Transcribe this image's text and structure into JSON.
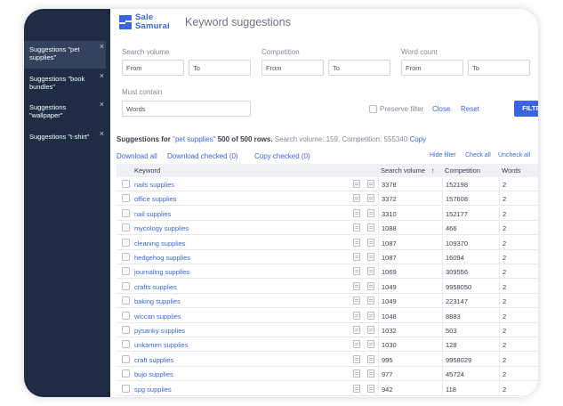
{
  "app": {
    "logo_line1": "Sale",
    "logo_line2": "Samurai",
    "title": "Keyword suggestions",
    "brand_color": "#3a65e0"
  },
  "sidebar": {
    "items": [
      {
        "label": "Suggestions \"pet supplies\"",
        "active": true
      },
      {
        "label": "Suggestions \"book bundles\"",
        "active": false
      },
      {
        "label": "Suggestions \"wallpaper\"",
        "active": false
      },
      {
        "label": "Suggestions \"t-shirt\"",
        "active": false
      }
    ],
    "close_glyph": "×"
  },
  "filters": {
    "search_volume_label": "Search volume",
    "competition_label": "Competition",
    "word_count_label": "Word count",
    "must_contain_label": "Must contain",
    "from_placeholder": "From",
    "to_placeholder": "To",
    "words_placeholder": "Words",
    "preserve_filter_label": "Preserve filter",
    "close_label": "Close",
    "reset_label": "Reset",
    "filter_button": "FILTER"
  },
  "summary": {
    "prefix": "Suggestions for",
    "query": "\"pet supplies\"",
    "rows": "500 of 500 rows.",
    "stats": "Search volume: 159, Competition: 555340",
    "copy": "Copy"
  },
  "actions": {
    "download_all": "Download all",
    "download_checked": "Download checked (0)",
    "copy_checked": "Copy checked (0)",
    "hide_filter": "Hide filter",
    "check_all": "Check all",
    "uncheck_all": "Uncheck all"
  },
  "table": {
    "columns": {
      "keyword": "Keyword",
      "search_volume": "Search volume",
      "competition": "Competition",
      "words": "Words",
      "sort_glyph": "↑"
    },
    "rows": [
      {
        "keyword": "nails supplies",
        "volume": "3378",
        "competition": "152198",
        "words": "2"
      },
      {
        "keyword": "office supplies",
        "volume": "3372",
        "competition": "157608",
        "words": "2"
      },
      {
        "keyword": "nail supplies",
        "volume": "3310",
        "competition": "152177",
        "words": "2"
      },
      {
        "keyword": "mycology supplies",
        "volume": "1088",
        "competition": "466",
        "words": "2"
      },
      {
        "keyword": "cleaning supplies",
        "volume": "1087",
        "competition": "109370",
        "words": "2"
      },
      {
        "keyword": "hedgehog supplies",
        "volume": "1087",
        "competition": "16094",
        "words": "2"
      },
      {
        "keyword": "journaling supplies",
        "volume": "1069",
        "competition": "309556",
        "words": "2"
      },
      {
        "keyword": "crafts supplies",
        "volume": "1049",
        "competition": "9958050",
        "words": "2"
      },
      {
        "keyword": "baking supplies",
        "volume": "1049",
        "competition": "223147",
        "words": "2"
      },
      {
        "keyword": "wiccan supplies",
        "volume": "1048",
        "competition": "8883",
        "words": "2"
      },
      {
        "keyword": "pysanky supplies",
        "volume": "1032",
        "competition": "503",
        "words": "2"
      },
      {
        "keyword": "unkamen supplies",
        "volume": "1030",
        "competition": "128",
        "words": "2"
      },
      {
        "keyword": "craft supplies",
        "volume": "995",
        "competition": "9958029",
        "words": "2"
      },
      {
        "keyword": "bujo supplies",
        "volume": "977",
        "competition": "45724",
        "words": "2"
      },
      {
        "keyword": "spg supplies",
        "volume": "942",
        "competition": "118",
        "words": "2"
      }
    ]
  }
}
